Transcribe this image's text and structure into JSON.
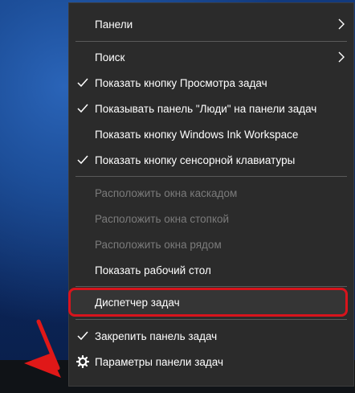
{
  "menu": {
    "items": [
      {
        "label": "Панели",
        "checked": false,
        "disabled": false,
        "submenu": true
      },
      {
        "label": "Поиск",
        "checked": false,
        "disabled": false,
        "submenu": true
      },
      {
        "label": "Показать кнопку Просмотра задач",
        "checked": true,
        "disabled": false
      },
      {
        "label": "Показывать панель \"Люди\" на панели задач",
        "checked": true,
        "disabled": false
      },
      {
        "label": "Показать кнопку Windows Ink Workspace",
        "checked": false,
        "disabled": false
      },
      {
        "label": "Показать кнопку сенсорной клавиатуры",
        "checked": true,
        "disabled": false
      },
      {
        "label": "Расположить окна каскадом",
        "checked": false,
        "disabled": true
      },
      {
        "label": "Расположить окна стопкой",
        "checked": false,
        "disabled": true
      },
      {
        "label": "Расположить окна рядом",
        "checked": false,
        "disabled": true
      },
      {
        "label": "Показать рабочий стол",
        "checked": false,
        "disabled": false
      },
      {
        "label": "Диспетчер задач",
        "checked": false,
        "disabled": false,
        "highlighted": true
      },
      {
        "label": "Закрепить панель задач",
        "checked": true,
        "disabled": false
      },
      {
        "label": "Параметры панели задач",
        "checked": false,
        "disabled": false,
        "icon": "gear-icon"
      }
    ]
  },
  "colors": {
    "menu_bg": "#2b2b2b",
    "text": "#ffffff",
    "disabled_text": "#7b7b7b",
    "highlight_border": "#d8141c",
    "arrow": "#e01818",
    "taskbar": "#101317"
  }
}
